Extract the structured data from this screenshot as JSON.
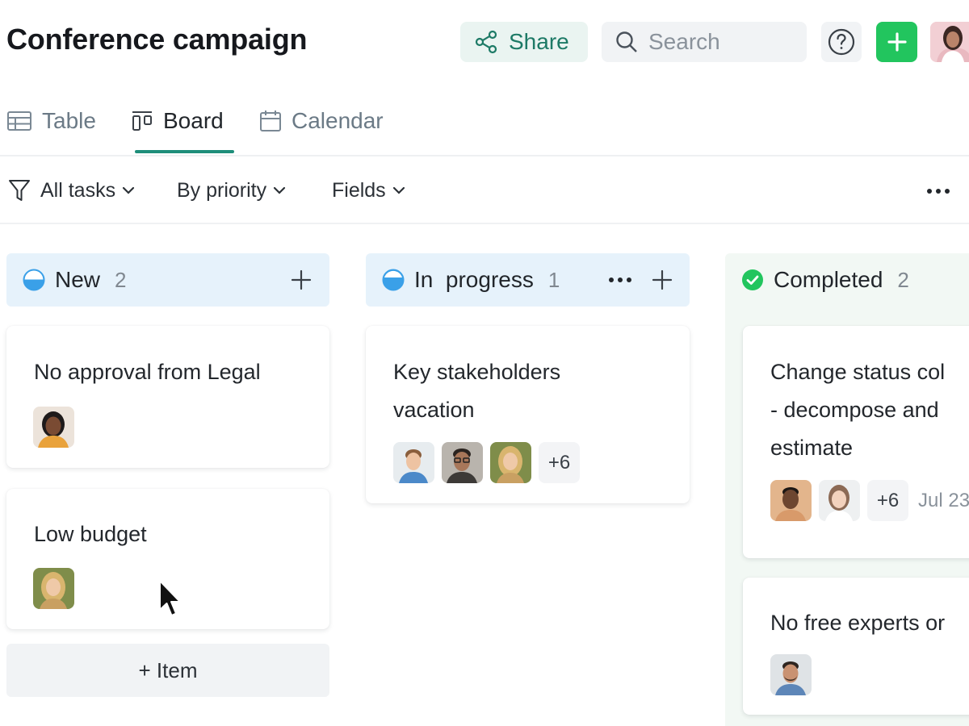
{
  "header": {
    "title": "Conference campaign",
    "share_label": "Share",
    "search_placeholder": "Search",
    "help_symbol": "?",
    "add_symbol": "+"
  },
  "tabs": [
    {
      "label": "Table",
      "icon": "table-icon",
      "active": false
    },
    {
      "label": "Board",
      "icon": "board-icon",
      "active": true
    },
    {
      "label": "Calendar",
      "icon": "calendar-icon",
      "active": false
    }
  ],
  "toolbar": {
    "filter_label": "All tasks",
    "group_label": "By priority",
    "fields_label": "Fields"
  },
  "columns": [
    {
      "name": "New",
      "count": "2",
      "status_color": "#3aa0e8",
      "cards": [
        {
          "title": "No approval from Legal",
          "avatars": [
            "avatar-woman-dark-hair"
          ]
        },
        {
          "title": "Low budget",
          "avatars": [
            "avatar-woman-blonde"
          ]
        }
      ],
      "add_item_label": "+ Item"
    },
    {
      "name": "In  progress",
      "count": "1",
      "status_color": "#3aa0e8",
      "cards": [
        {
          "title_lines": [
            "Key stakeholders",
            "vacation"
          ],
          "avatars": [
            "avatar-man-light",
            "avatar-man-glasses",
            "avatar-woman-blonde"
          ],
          "more": "+6"
        }
      ]
    },
    {
      "name": "Completed",
      "count": "2",
      "status_color": "#22c55e",
      "cards": [
        {
          "title_lines": [
            "Change status col",
            "- decompose and",
            "estimate"
          ],
          "avatars": [
            "avatar-man-dark",
            "avatar-woman-light"
          ],
          "more": "+6",
          "due": "Jul 23"
        },
        {
          "title": "No free experts or",
          "avatars": [
            "avatar-man-beard"
          ]
        }
      ]
    }
  ],
  "colors": {
    "accent": "#1e8e7a",
    "add_button": "#22c55e",
    "column_header": "#e6f2fb"
  }
}
